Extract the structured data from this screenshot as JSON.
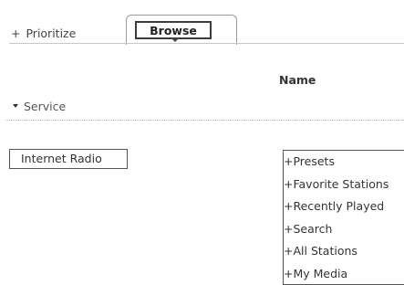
{
  "tabs": {
    "prioritize_plus": "+",
    "prioritize_label": "Prioritize",
    "browse_label": "Browse"
  },
  "table": {
    "name_header": "Name"
  },
  "section": {
    "label": "Service"
  },
  "service": {
    "selected_label": "Internet Radio"
  },
  "menu": {
    "items": [
      {
        "label": "+Presets"
      },
      {
        "label": "+Favorite Stations"
      },
      {
        "label": "+Recently Played"
      },
      {
        "label": "+Search"
      },
      {
        "label": "+All Stations"
      },
      {
        "label": "+My Media"
      }
    ]
  }
}
